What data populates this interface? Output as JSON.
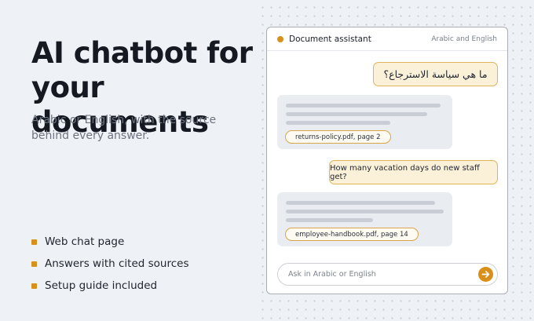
{
  "hero": {
    "headline": "AI chatbot for your documents",
    "subhead": "Arabic or English, with the source behind every answer."
  },
  "features": [
    "Web chat page",
    "Answers with cited sources",
    "Setup guide included"
  ],
  "chat": {
    "title": "Document assistant",
    "language_label": "Arabic and English",
    "messages": [
      {
        "role": "user",
        "text": "ما هي سياسة الاسترجاع؟"
      },
      {
        "role": "assistant",
        "citation": "returns-policy.pdf, page 2"
      },
      {
        "role": "user",
        "text": "How many vacation days do new staff get?"
      },
      {
        "role": "assistant",
        "citation": "employee-handbook.pdf, page 14"
      }
    ],
    "input": {
      "placeholder": "Ask in Arabic or English",
      "value": ""
    },
    "send_icon": "arrow-right-icon"
  },
  "colors": {
    "accent": "#d9901a",
    "user_bubble": "#fbf0d8",
    "bot_bubble": "#e9ecf0",
    "background": "#eef1f5"
  }
}
